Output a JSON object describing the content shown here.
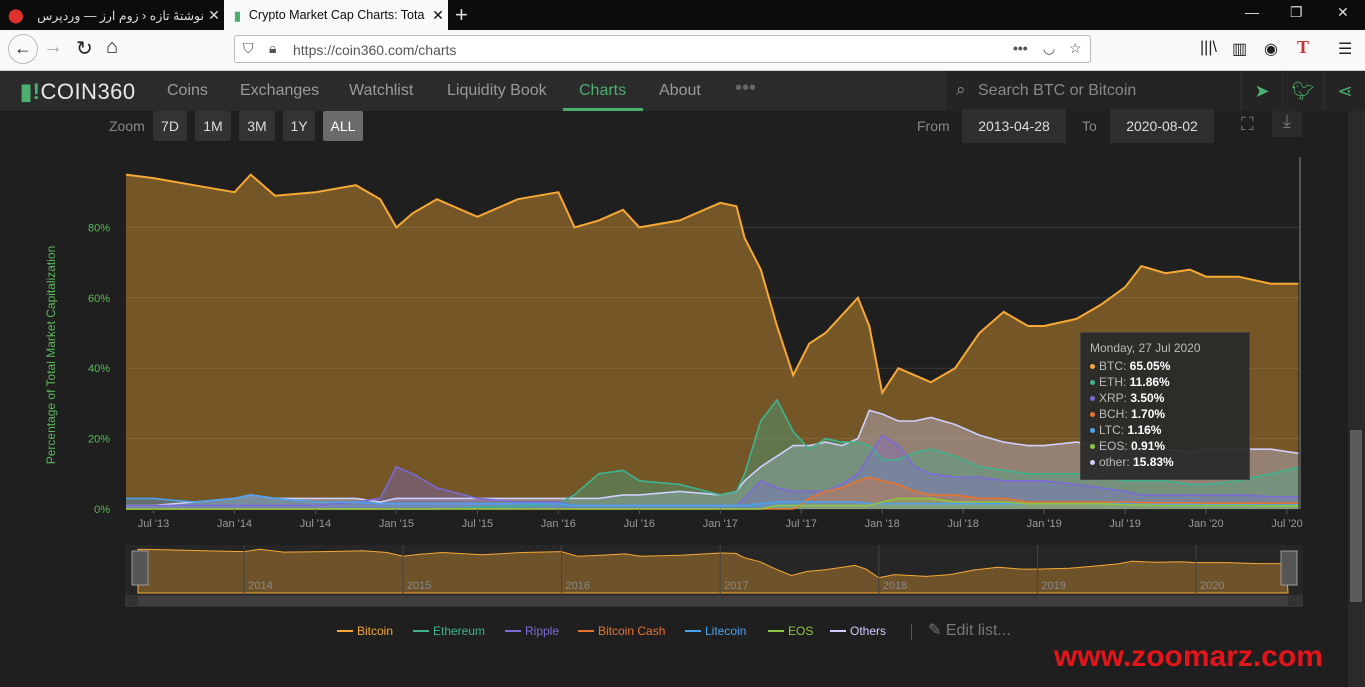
{
  "browser": {
    "tabs": [
      {
        "title": "نوشتهٔ تازه ‹ زوم ارز — وردپرس"
      },
      {
        "title": "Crypto Market Cap Charts: Tota"
      }
    ],
    "url": "https://coin360.com/charts"
  },
  "site": {
    "logo_text": "COIN360",
    "nav": [
      "Coins",
      "Exchanges",
      "Watchlist",
      "Liquidity Book",
      "Charts",
      "About"
    ],
    "active_nav": "Charts",
    "search_placeholder": "Search BTC or Bitcoin"
  },
  "controls": {
    "zoom_label": "Zoom",
    "zoom_options": [
      "7D",
      "1M",
      "3M",
      "1Y",
      "ALL"
    ],
    "selected_zoom": "ALL",
    "from_label": "From",
    "from_date": "2013-04-28",
    "to_label": "To",
    "to_date": "2020-08-02"
  },
  "tooltip": {
    "date": "Monday, 27 Jul 2020",
    "rows": [
      {
        "label": "BTC:",
        "value": "65.05%",
        "color": "#f7a935"
      },
      {
        "label": "ETH:",
        "value": "11.86%",
        "color": "#3fb38f"
      },
      {
        "label": "XRP:",
        "value": "3.50%",
        "color": "#7b6bd6"
      },
      {
        "label": "BCH:",
        "value": "1.70%",
        "color": "#e8752e"
      },
      {
        "label": "LTC:",
        "value": "1.16%",
        "color": "#4aa3f0"
      },
      {
        "label": "EOS:",
        "value": "0.91%",
        "color": "#8ec641"
      },
      {
        "label": "other:",
        "value": "15.83%",
        "color": "#cfd0ff"
      }
    ]
  },
  "legend": {
    "items": [
      {
        "name": "Bitcoin",
        "color": "#f7a935"
      },
      {
        "name": "Ethereum",
        "color": "#3fb38f"
      },
      {
        "name": "Ripple",
        "color": "#7b6bd6"
      },
      {
        "name": "Bitcoin Cash",
        "color": "#e8752e"
      },
      {
        "name": "Litecoin",
        "color": "#4aa3f0"
      },
      {
        "name": "EOS",
        "color": "#8ec641"
      },
      {
        "name": "Others",
        "color": "#cfd0ff"
      }
    ],
    "edit_label": "Edit list..."
  },
  "watermark": "www.zoomarz.com",
  "chart_data": {
    "type": "area",
    "ylabel": "Percentage of Total Market Capitalization",
    "yticks": [
      "0%",
      "20%",
      "40%",
      "60%",
      "80%"
    ],
    "ylim": [
      0,
      100
    ],
    "xticks": [
      "Jul '13",
      "Jan '14",
      "Jul '14",
      "Jan '15",
      "Jul '15",
      "Jan '16",
      "Jul '16",
      "Jan '17",
      "Jul '17",
      "Jan '18",
      "Jul '18",
      "Jan '19",
      "Jul '19",
      "Jan '20",
      "Jul '20"
    ],
    "navigator_years": [
      "2014",
      "2015",
      "2016",
      "2017",
      "2018",
      "2019",
      "2020"
    ],
    "x": [
      2013.33,
      2013.5,
      2013.75,
      2014.0,
      2014.1,
      2014.25,
      2014.5,
      2014.75,
      2014.9,
      2015.0,
      2015.1,
      2015.25,
      2015.5,
      2015.75,
      2016.0,
      2016.1,
      2016.25,
      2016.4,
      2016.5,
      2016.75,
      2017.0,
      2017.1,
      2017.15,
      2017.25,
      2017.35,
      2017.45,
      2017.55,
      2017.65,
      2017.75,
      2017.85,
      2017.92,
      2018.0,
      2018.1,
      2018.2,
      2018.3,
      2018.45,
      2018.6,
      2018.75,
      2018.9,
      2019.0,
      2019.2,
      2019.35,
      2019.5,
      2019.6,
      2019.75,
      2019.9,
      2020.0,
      2020.2,
      2020.4,
      2020.57
    ],
    "series": [
      {
        "name": "Bitcoin",
        "values": [
          95,
          94,
          92,
          90,
          95,
          89,
          90,
          92,
          88,
          80,
          84,
          88,
          83,
          88,
          90,
          80,
          82,
          85,
          80,
          82,
          87,
          86,
          77,
          68,
          52,
          38,
          47,
          50,
          55,
          60,
          52,
          33,
          40,
          38,
          36,
          40,
          50,
          56,
          52,
          52,
          54,
          58,
          63,
          69,
          67,
          68,
          66,
          66,
          64,
          64
        ]
      },
      {
        "name": "Ethereum",
        "values": [
          0,
          0,
          0,
          0,
          0,
          0,
          0,
          0,
          0,
          0,
          0,
          0,
          0.5,
          0.8,
          1.5,
          4,
          10,
          11,
          8,
          7,
          4,
          5,
          10,
          25,
          31,
          22,
          17,
          20,
          19,
          19,
          18,
          14,
          14,
          16,
          17,
          15,
          12,
          11,
          10,
          10,
          10,
          9,
          8,
          8,
          8,
          7,
          7,
          8,
          10,
          11.86
        ]
      },
      {
        "name": "Ripple",
        "values": [
          1,
          1,
          1,
          1,
          1,
          1,
          1,
          2,
          3,
          12,
          10,
          6,
          3,
          2,
          2,
          1,
          1,
          1,
          1,
          1,
          1,
          1,
          3,
          8,
          6,
          5,
          5,
          5,
          7,
          10,
          15,
          21,
          18,
          12,
          10,
          9,
          9,
          8,
          8,
          8,
          7,
          6,
          5,
          4,
          4,
          4,
          4,
          4,
          3.5,
          3.5
        ]
      },
      {
        "name": "Bitcoin Cash",
        "values": [
          0,
          0,
          0,
          0,
          0,
          0,
          0,
          0,
          0,
          0,
          0,
          0,
          0,
          0,
          0,
          0,
          0,
          0,
          0,
          0,
          0,
          0,
          0,
          0,
          0,
          0,
          3,
          5,
          6,
          8,
          9,
          8,
          7,
          5,
          4,
          4,
          3,
          3,
          2,
          2,
          2,
          2,
          2,
          1.8,
          1.8,
          1.8,
          1.7,
          1.7,
          1.7,
          1.7
        ]
      },
      {
        "name": "Litecoin",
        "values": [
          3,
          3,
          2,
          3,
          4,
          3,
          2,
          2,
          1.5,
          1.5,
          1.5,
          1.5,
          1.5,
          1.5,
          1.5,
          1,
          1,
          1,
          1,
          1,
          1,
          1,
          1,
          1.5,
          2,
          2,
          2,
          2,
          2,
          2,
          1.5,
          1.5,
          1.5,
          1.5,
          1.5,
          1.5,
          1.5,
          1.5,
          1.5,
          1.5,
          1.5,
          1.5,
          1.5,
          1.3,
          1.3,
          1.3,
          1.2,
          1.2,
          1.16,
          1.16
        ]
      },
      {
        "name": "EOS",
        "values": [
          0,
          0,
          0,
          0,
          0,
          0,
          0,
          0,
          0,
          0,
          0,
          0,
          0,
          0,
          0,
          0,
          0,
          0,
          0,
          0,
          0,
          0,
          0,
          0,
          1,
          1,
          1,
          1,
          1,
          1,
          1,
          2,
          3,
          3,
          3,
          2,
          2,
          2,
          1.5,
          1.5,
          1.5,
          1.5,
          1.2,
          1.1,
          1,
          1,
          1,
          1,
          0.91,
          0.91
        ]
      },
      {
        "name": "Others",
        "values": [
          1,
          1,
          2,
          3,
          4,
          3,
          3,
          3,
          2,
          3,
          3,
          3,
          3,
          3,
          3,
          3,
          3,
          4,
          4,
          5,
          4,
          5,
          8,
          12,
          15,
          18,
          18,
          19,
          18,
          20,
          28,
          27,
          25,
          25,
          26,
          24,
          21,
          19,
          18,
          18,
          19,
          18,
          17,
          17,
          17,
          16,
          17,
          17,
          17,
          15.83
        ]
      }
    ]
  }
}
